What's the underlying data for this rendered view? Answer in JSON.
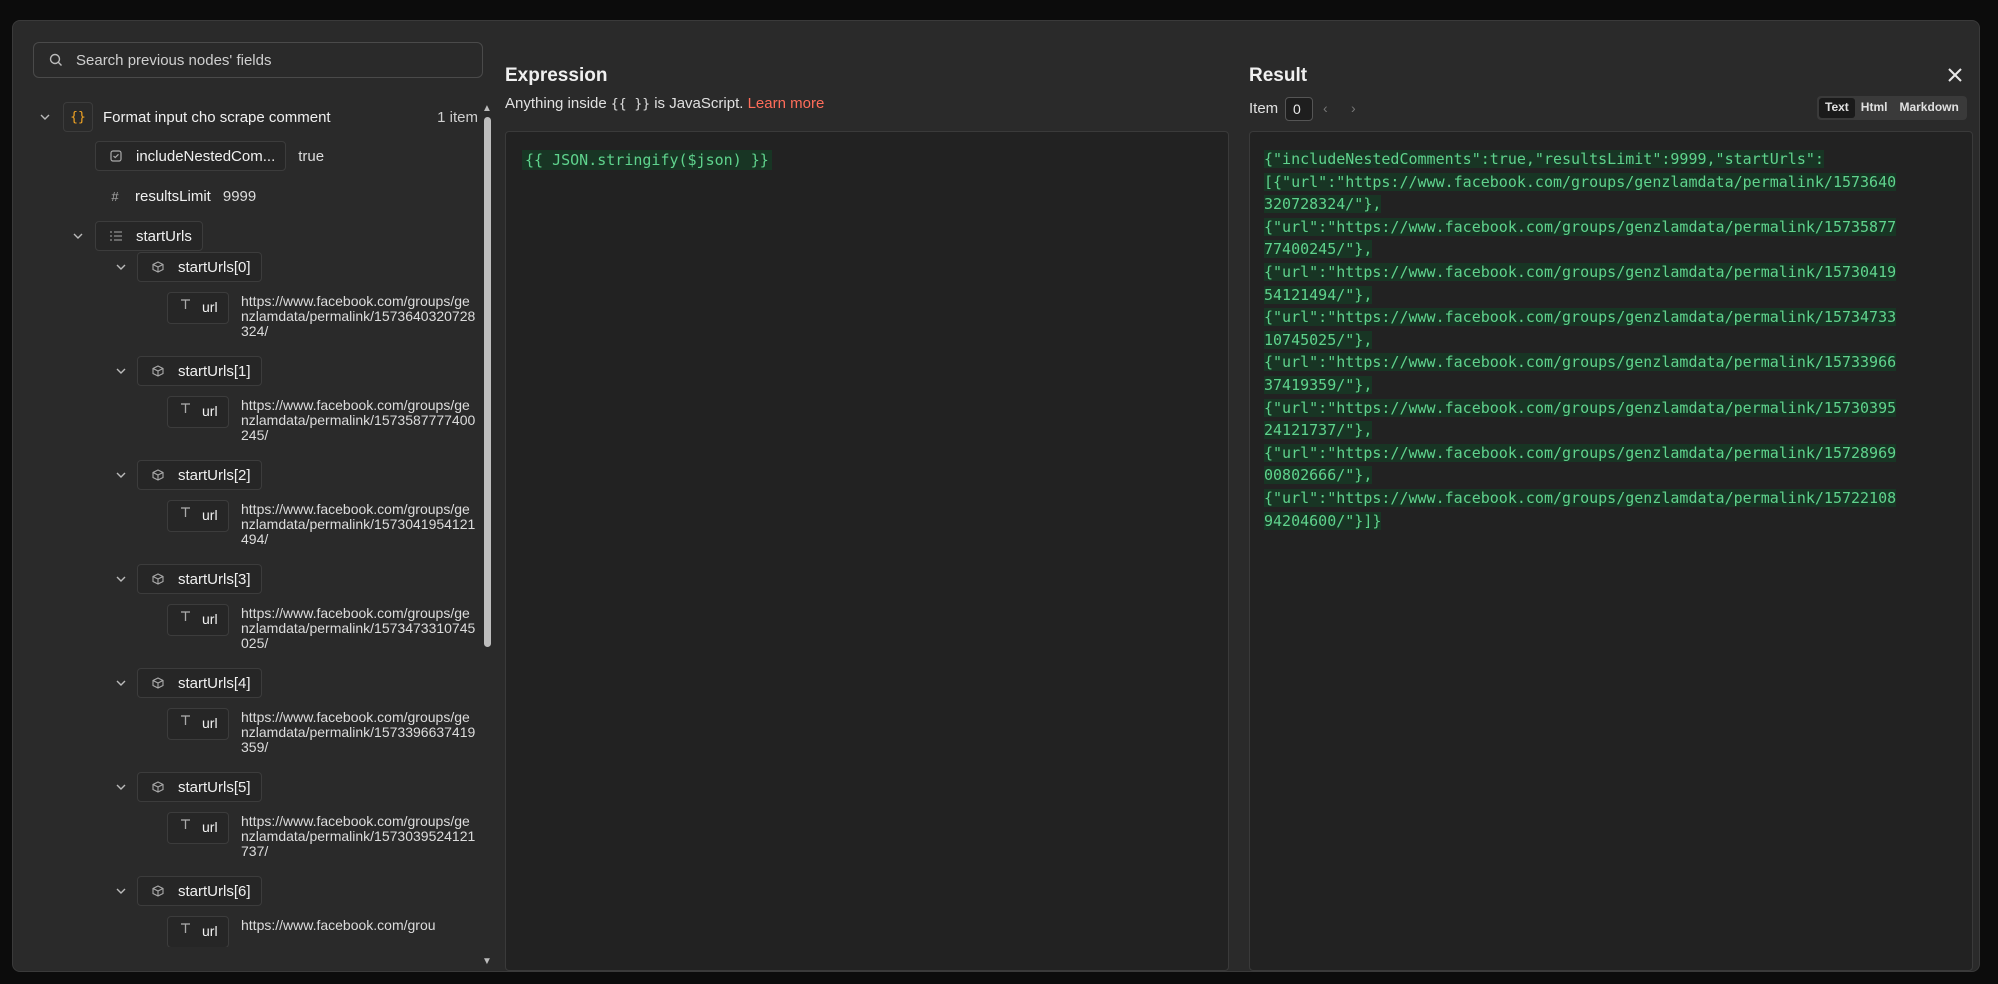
{
  "search": {
    "placeholder": "Search previous nodes' fields"
  },
  "tree": {
    "node": {
      "name": "Format input cho scrape comment",
      "count": "1 item"
    },
    "fields": [
      {
        "name": "includeNestedCom...",
        "value": "true"
      },
      {
        "name": "resultsLimit",
        "value": "9999"
      }
    ],
    "array_name": "startUrls",
    "url_key": "url",
    "items": [
      {
        "name": "startUrls[0]",
        "url": "https://www.facebook.com/groups/genzlamdata/permalink/1573640320728324/"
      },
      {
        "name": "startUrls[1]",
        "url": "https://www.facebook.com/groups/genzlamdata/permalink/1573587777400245/"
      },
      {
        "name": "startUrls[2]",
        "url": "https://www.facebook.com/groups/genzlamdata/permalink/1573041954121494/"
      },
      {
        "name": "startUrls[3]",
        "url": "https://www.facebook.com/groups/genzlamdata/permalink/1573473310745025/"
      },
      {
        "name": "startUrls[4]",
        "url": "https://www.facebook.com/groups/genzlamdata/permalink/1573396637419359/"
      },
      {
        "name": "startUrls[5]",
        "url": "https://www.facebook.com/groups/genzlamdata/permalink/1573039524121737/"
      },
      {
        "name": "startUrls[6]",
        "url": "https://www.facebook.com/grou"
      }
    ]
  },
  "expression": {
    "title": "Expression",
    "hint_prefix": "Anything inside",
    "hint_braces": "{{ }}",
    "hint_suffix": "is JavaScript.",
    "learn_more": "Learn more",
    "code": "{{ JSON.stringify($json) }}"
  },
  "result": {
    "title": "Result",
    "item_label": "Item",
    "item_value": "0",
    "tabs": [
      "Text",
      "Html",
      "Markdown"
    ],
    "active_tab": "Text",
    "lines": [
      "{\"includeNestedComments\":true,\"resultsLimit\":9999,\"startUrls\":",
      "[{\"url\":\"https://www.facebook.com/groups/genzlamdata/permalink/1573640",
      "320728324/\"},",
      "{\"url\":\"https://www.facebook.com/groups/genzlamdata/permalink/15735877",
      "77400245/\"},",
      "{\"url\":\"https://www.facebook.com/groups/genzlamdata/permalink/15730419",
      "54121494/\"},",
      "{\"url\":\"https://www.facebook.com/groups/genzlamdata/permalink/15734733",
      "10745025/\"},",
      "{\"url\":\"https://www.facebook.com/groups/genzlamdata/permalink/15733966",
      "37419359/\"},",
      "{\"url\":\"https://www.facebook.com/groups/genzlamdata/permalink/15730395",
      "24121737/\"},",
      "{\"url\":\"https://www.facebook.com/groups/genzlamdata/permalink/15728969",
      "00802666/\"},",
      "{\"url\":\"https://www.facebook.com/groups/genzlamdata/permalink/15722108",
      "94204600/\"}]}"
    ]
  },
  "colors": {
    "accent": "#ff6d5a",
    "code_green": "#5fd38d",
    "code_bg": "#183524",
    "node_icon": "#f5a623"
  }
}
